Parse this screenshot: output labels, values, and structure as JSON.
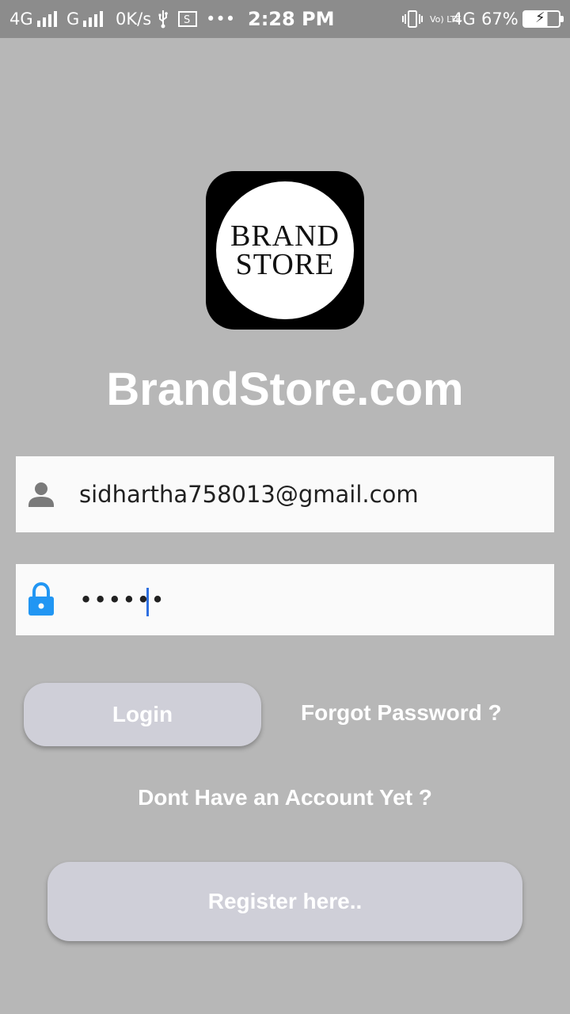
{
  "status_bar": {
    "network1": "4G",
    "network2": "G",
    "speed": "0K/s",
    "more": "•••",
    "time": "2:28 PM",
    "volte": "Vo) LTE",
    "network3": "4G",
    "battery": "67%",
    "icons": [
      "signal-icon",
      "usb-icon",
      "screenshot-icon",
      "vibrate-icon",
      "battery-charging-icon"
    ]
  },
  "logo": {
    "line1": "BRAND",
    "line2": "STORE"
  },
  "app_name": "BrandStore.com",
  "email_field": {
    "icon": "person-icon",
    "value": "sidhartha758013@gmail.com"
  },
  "password_field": {
    "icon": "lock-icon",
    "masked_value": "••••••"
  },
  "buttons": {
    "login": "Login",
    "forgot_password": "Forgot Password ?",
    "no_account": "Dont Have an Account Yet ?",
    "register": "Register here.."
  },
  "colors": {
    "background": "#b7b7b7",
    "status_bar": "#8c8c8c",
    "button": "#cfcfd8",
    "lock_icon": "#2196f3",
    "person_icon": "#7a7a7a"
  }
}
